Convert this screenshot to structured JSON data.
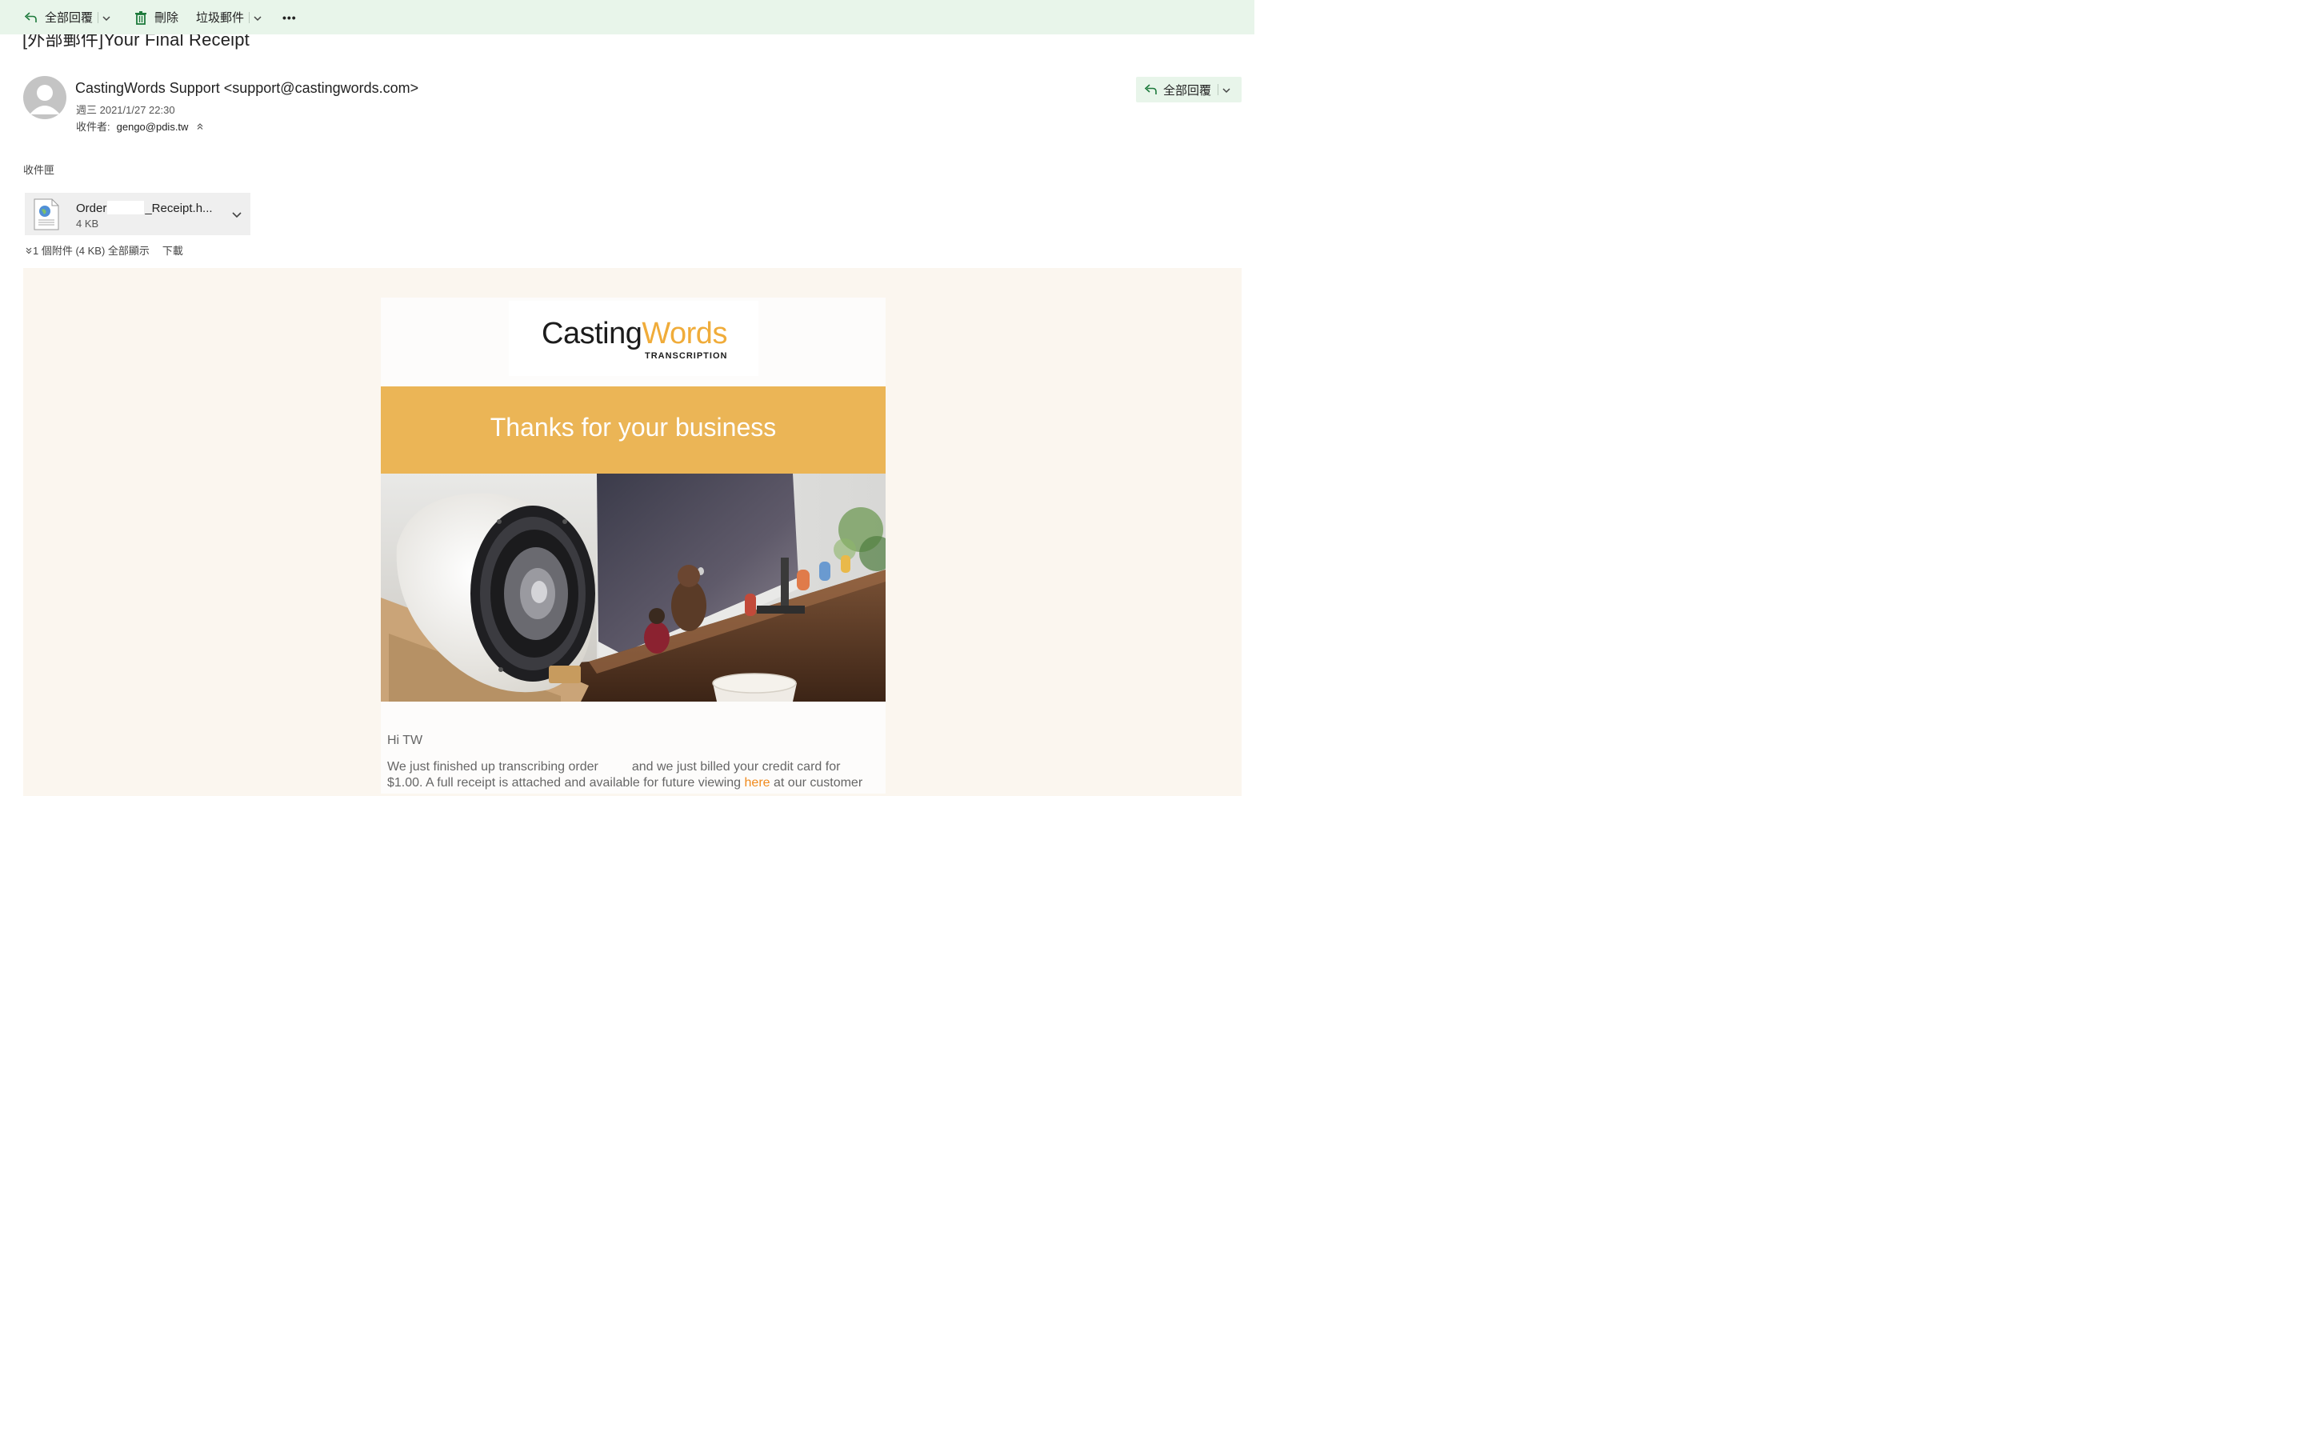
{
  "toolbar": {
    "reply_all_label": "全部回覆",
    "delete_label": "刪除",
    "junk_label": "垃圾郵件",
    "more_label": "•••"
  },
  "message": {
    "subject": "[外部郵件]Your Final Receipt",
    "sender": "CastingWords Support <support@castingwords.com>",
    "date": "週三 2021/1/27 22:30",
    "recipient_label": "收件者:",
    "recipient": "gengo@pdis.tw",
    "reply_all_label": "全部回覆",
    "folder": "收件匣"
  },
  "attachment": {
    "name_prefix": "Order",
    "name_suffix": "_Receipt.h...",
    "size": "4 KB",
    "summary": "1 個附件 (4 KB) 全部顯示",
    "download": "下載"
  },
  "email": {
    "logo_left": "Casting",
    "logo_right": "Words",
    "logo_sub": "TRANSCRIPTION",
    "banner_title": "Thanks for your business",
    "greeting": "Hi TW",
    "body_part1": "We just finished up transcribing order",
    "body_part2": "and we just billed your credit card for $1.00. A full receipt is attached and available for future viewing",
    "body_link": "here",
    "body_part3": "at our customer"
  },
  "colors": {
    "toolbar_bg": "#e8f5ea",
    "accent_green": "#1e7a3c",
    "banner_yellow": "#ebb556",
    "logo_orange": "#f0ac3a",
    "link_orange": "#f08a1d",
    "email_bg": "#fbf6ef"
  },
  "icons": [
    "reply-all-icon",
    "chevron-down-icon",
    "trash-icon",
    "more-icon",
    "avatar-icon",
    "collapse-icon",
    "html-file-icon",
    "expand-attachments-icon"
  ]
}
